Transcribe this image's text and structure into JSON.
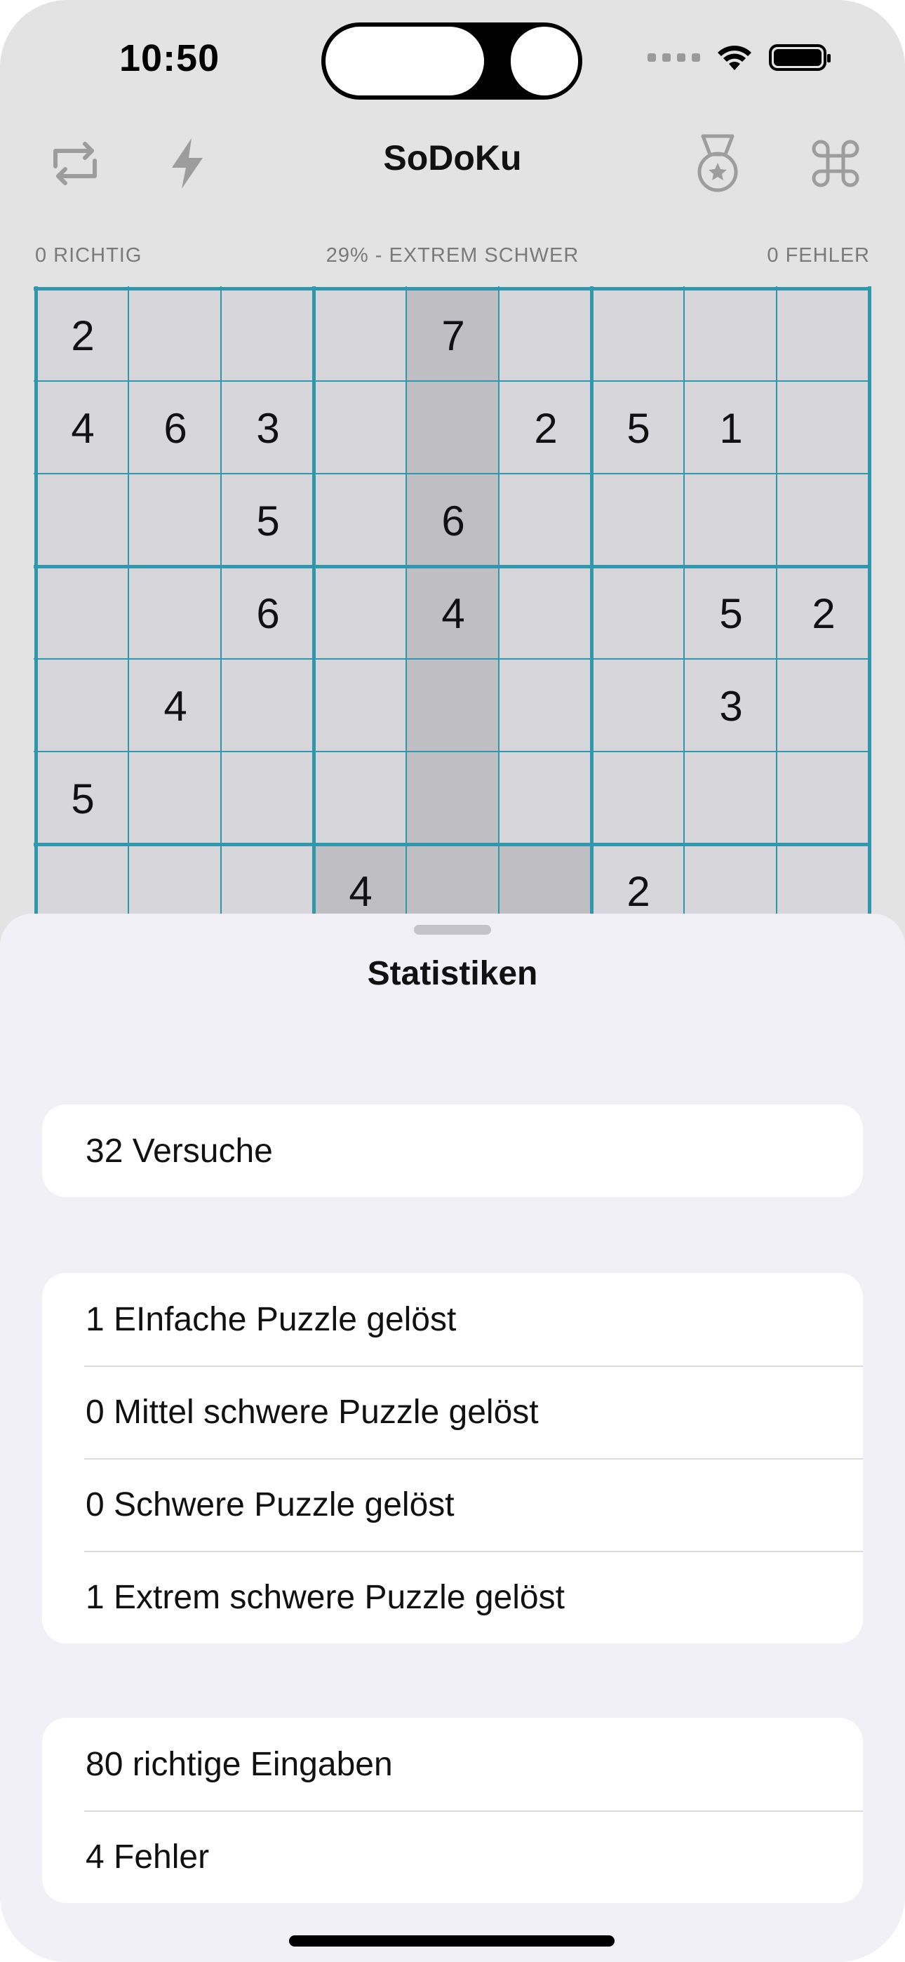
{
  "status": {
    "time": "10:50"
  },
  "toolbar": {
    "title": "SoDoKu",
    "icons": [
      "refresh-icon",
      "lightning-icon",
      "medal-icon",
      "command-icon"
    ]
  },
  "info": {
    "correct": "0 RICHTIG",
    "difficulty": "29% - EXTREM SCHWER",
    "errors": "0 FEHLER"
  },
  "grid": {
    "rows": [
      [
        "2",
        "",
        "",
        "",
        "7",
        "",
        "",
        "",
        ""
      ],
      [
        "4",
        "6",
        "3",
        "",
        "",
        "2",
        "5",
        "1",
        ""
      ],
      [
        "",
        "",
        "5",
        "",
        "6",
        "",
        "",
        "",
        ""
      ],
      [
        "",
        "",
        "6",
        "",
        "4",
        "",
        "",
        "5",
        "2"
      ],
      [
        "",
        "4",
        "",
        "",
        "",
        "",
        "",
        "3",
        ""
      ],
      [
        "5",
        "",
        "",
        "",
        "",
        "",
        "",
        "",
        ""
      ],
      [
        "",
        "",
        "",
        "4",
        "",
        "",
        "2",
        "",
        ""
      ],
      [
        "",
        "",
        "",
        "",
        "",
        "",
        "",
        "",
        ""
      ],
      [
        "",
        "",
        "",
        "",
        "",
        "",
        "",
        "",
        ""
      ]
    ],
    "highlight_column": 4,
    "highlight_cells": [
      [
        6,
        3
      ],
      [
        6,
        5
      ]
    ]
  },
  "sheet": {
    "title": "Statistiken",
    "sections": [
      [
        "32 Versuche"
      ],
      [
        "1 EInfache Puzzle gelöst",
        "0 Mittel schwere Puzzle gelöst",
        "0 Schwere Puzzle gelöst",
        "1 Extrem schwere Puzzle gelöst"
      ],
      [
        "80 richtige Eingaben",
        "4 Fehler"
      ]
    ]
  },
  "colors": {
    "grid_line": "#2f98ad",
    "cell": "#d7d6db",
    "cell_highlight": "#bfbec3",
    "sheet_bg": "#f1f0f6"
  }
}
